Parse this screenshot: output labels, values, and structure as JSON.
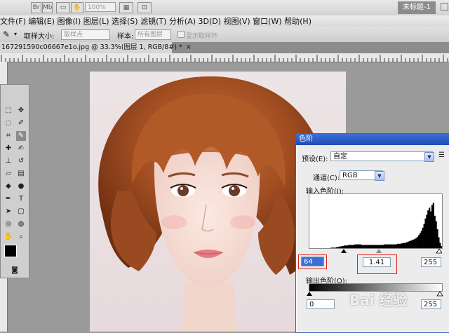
{
  "menubar": {
    "items": [
      "文件(F)",
      "编辑(E)",
      "图像(I)",
      "图层(L)",
      "选择(S)",
      "滤镜(T)",
      "分析(A)",
      "3D(D)",
      "视图(V)",
      "窗口(W)",
      "帮助(H)"
    ],
    "app_badges": [
      "Br",
      "Mb"
    ],
    "zoom": "100%",
    "window_title": "未标题-1"
  },
  "options": {
    "sample_size_label": "取样大小:",
    "sample_size_value": "取样点",
    "sample_label": "样本:",
    "sample_value": "所有图层",
    "show_ring_label": "显示取样环"
  },
  "document": {
    "tab_title": "167291590c06667e1o.jpg @ 33.3%(图层 1, RGB/8#) *",
    "close": "×"
  },
  "levels": {
    "title": "色阶",
    "preset_label": "预设(E):",
    "preset_value": "自定",
    "channel_label": "通道(C):",
    "channel_value": "RGB",
    "input_label": "输入色阶(I):",
    "input_black": "64",
    "input_gamma": "1.41",
    "input_white": "255",
    "output_label": "输出色阶(O):",
    "output_black": "0",
    "output_white": "255",
    "histogram_bins": [
      0,
      0,
      0,
      0,
      0,
      0,
      0,
      0,
      0,
      0,
      0,
      0,
      0,
      0,
      0,
      0,
      1,
      1,
      1,
      1,
      2,
      2,
      3,
      3,
      4,
      4,
      5,
      5,
      5,
      6,
      6,
      6,
      6,
      6,
      7,
      7,
      7,
      7,
      7,
      6,
      6,
      6,
      6,
      6,
      6,
      6,
      6,
      6,
      6,
      6,
      6,
      6,
      6,
      6,
      6,
      6,
      7,
      7,
      7,
      7,
      7,
      7,
      7,
      7,
      7,
      7,
      8,
      8,
      8,
      9,
      9,
      10,
      10,
      11,
      12,
      13,
      14,
      15,
      16,
      17,
      19,
      21,
      24,
      28,
      32,
      38,
      45,
      55,
      62,
      70,
      75,
      68,
      80,
      84,
      60,
      50,
      35,
      20,
      10,
      4
    ]
  },
  "watermark": "Bai 经验",
  "colors": {
    "dialog_title": "#1d4cb5",
    "highlight": "#e02020"
  }
}
